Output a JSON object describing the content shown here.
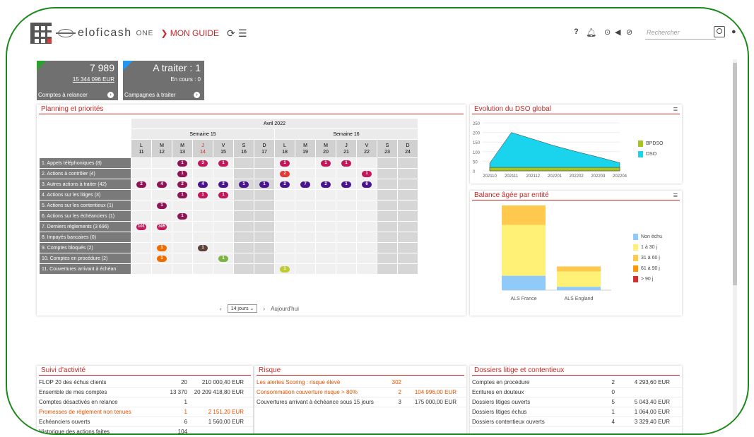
{
  "header": {
    "logo_text": "eloficash",
    "logo_suffix": "ONE",
    "guide": "❯ MON GUIDE",
    "search_placeholder": "Rechercher",
    "help": "?"
  },
  "kpis": [
    {
      "value": "7 989",
      "amount": "15 344 096 EUR",
      "footer": "Comptes à relancer",
      "color": "#2e9e2e"
    },
    {
      "value": "A traiter : 1",
      "amount": "En cours : 0",
      "footer": "Campagnes à traiter",
      "color": "#2196f3"
    }
  ],
  "planning": {
    "title": "Planning et priorités",
    "month": "Avril 2022",
    "weeks": [
      "Semaine 15",
      "Semaine 16"
    ],
    "days": [
      {
        "l": "L",
        "n": "11"
      },
      {
        "l": "M",
        "n": "12"
      },
      {
        "l": "M",
        "n": "13"
      },
      {
        "l": "J",
        "n": "14",
        "today": true
      },
      {
        "l": "V",
        "n": "15"
      },
      {
        "l": "S",
        "n": "16",
        "we": true
      },
      {
        "l": "D",
        "n": "17",
        "we": true
      },
      {
        "l": "L",
        "n": "18"
      },
      {
        "l": "M",
        "n": "19"
      },
      {
        "l": "M",
        "n": "20"
      },
      {
        "l": "J",
        "n": "21"
      },
      {
        "l": "V",
        "n": "22"
      },
      {
        "l": "S",
        "n": "23",
        "we": true
      },
      {
        "l": "D",
        "n": "24",
        "we": true
      }
    ],
    "rows": [
      {
        "label": "1. Appels téléphoniques (8)",
        "cells": {
          "2": [
            "1",
            "#8e1456"
          ],
          "3": [
            "3",
            "#c2185b"
          ],
          "4": [
            "1",
            "#c2185b"
          ],
          "7": [
            "1",
            "#c2185b"
          ],
          "9": [
            "1",
            "#c2185b"
          ],
          "10": [
            "1",
            "#c2185b"
          ]
        }
      },
      {
        "label": "2. Actions à contrôler (4)",
        "cells": {
          "2": [
            "1",
            "#8e1456"
          ],
          "7": [
            "2",
            "#e53935"
          ],
          "11": [
            "1",
            "#c2185b"
          ]
        }
      },
      {
        "label": "3. Autres actions à traiter (42)",
        "cells": {
          "0": [
            "2",
            "#8e1456"
          ],
          "1": [
            "4",
            "#8e1456"
          ],
          "2": [
            "2",
            "#8e1456"
          ],
          "3": [
            "4",
            "#4a148c"
          ],
          "4": [
            "2",
            "#4a148c"
          ],
          "5": [
            "1",
            "#4a148c"
          ],
          "6": [
            "1",
            "#4a148c"
          ],
          "7": [
            "2",
            "#4a148c"
          ],
          "8": [
            "7",
            "#4a148c"
          ],
          "9": [
            "2",
            "#4a148c"
          ],
          "10": [
            "1",
            "#4a148c"
          ],
          "11": [
            "6",
            "#4a148c"
          ]
        }
      },
      {
        "label": "4. Actions sur les litiges (3)",
        "cells": {
          "2": [
            "1",
            "#8e1456"
          ],
          "3": [
            "1",
            "#c2185b"
          ],
          "4": [
            "1",
            "#c2185b"
          ]
        }
      },
      {
        "label": "5. Actions sur les contentieux (1)",
        "cells": {
          "1": [
            "1",
            "#8e1456"
          ]
        }
      },
      {
        "label": "6. Actions sur les échéanciers (1)",
        "cells": {
          "2": [
            "1",
            "#8e1456"
          ]
        }
      },
      {
        "label": "7. Derniers règlements (3 696)",
        "cells": {
          "0": [
            "101",
            "#c2185b"
          ],
          "1": [
            "305",
            "#c2185b"
          ]
        }
      },
      {
        "label": "8. Impayés bancaires (0)",
        "cells": {}
      },
      {
        "label": "9. Comptes bloqués (2)",
        "cells": {
          "1": [
            "1",
            "#ef6c00"
          ],
          "3": [
            "1",
            "#5d4037"
          ]
        }
      },
      {
        "label": "10. Comptes en procédure (2)",
        "cells": {
          "1": [
            "1",
            "#ef6c00"
          ],
          "4": [
            "1",
            "#7cb342"
          ]
        }
      },
      {
        "label": "11. Couvertures arrivant à échéan",
        "cells": {
          "7": [
            "1",
            "#c0ca33"
          ]
        }
      }
    ],
    "footer": {
      "prev": "‹",
      "select": "14 jours",
      "next": "›",
      "today": "Aujourd'hui"
    }
  },
  "dso": {
    "title": "Evolution du DSO global",
    "chart_data": {
      "type": "area",
      "x": [
        "202110",
        "202111",
        "202112",
        "202201",
        "202202",
        "202203",
        "202204"
      ],
      "yticks": [
        "250",
        "200",
        "150",
        "100",
        "50",
        "0"
      ],
      "ylim": [
        0,
        250
      ],
      "series": [
        {
          "name": "BPDSO",
          "values": [
            18,
            18,
            18,
            18,
            18,
            18,
            18
          ],
          "color": "#a6c520"
        },
        {
          "name": "DSO",
          "values": [
            40,
            200,
            165,
            130,
            100,
            72,
            42
          ],
          "color": "#1ad4ee"
        }
      ]
    }
  },
  "balance": {
    "title": "Balance âgée par entité",
    "chart_data": {
      "type": "bar",
      "categories": [
        "ALS France",
        "ALS England"
      ],
      "series": [
        {
          "name": "Non échu",
          "values": [
            17,
            4
          ],
          "color": "#90caf9"
        },
        {
          "name": "1 à 30 j",
          "values": [
            60,
            18
          ],
          "color": "#fff176"
        },
        {
          "name": "31 à 60 j",
          "values": [
            23,
            6
          ],
          "color": "#ffc94d"
        },
        {
          "name": "61 à 90 j",
          "values": [
            0,
            0
          ],
          "color": "#ff9800"
        },
        {
          "name": "> 90 j",
          "values": [
            0,
            0
          ],
          "color": "#d32f2f"
        }
      ],
      "ylim": [
        0,
        100
      ]
    }
  },
  "suivi": {
    "title": "Suivi d'activité",
    "rows": [
      {
        "label": "FLOP 20 des échus clients",
        "n": "20",
        "amt": "210 000,40 EUR",
        "alert": false
      },
      {
        "label": "Ensemble de mes comptes",
        "n": "13 370",
        "amt": "20 209 418,80 EUR",
        "alert": false
      },
      {
        "label": "Comptes désactivés en relance",
        "n": "1",
        "amt": "",
        "alert": false
      },
      {
        "label": "Promesses de règlement non tenues",
        "n": "1",
        "amt": "2 151,20 EUR",
        "alert": true
      },
      {
        "label": "Echéanciers ouverts",
        "n": "6",
        "amt": "1 560,00 EUR",
        "alert": false
      },
      {
        "label": "Historique des actions faites",
        "n": "104",
        "amt": "",
        "alert": false
      }
    ]
  },
  "risque": {
    "title": "Risque",
    "rows": [
      {
        "label": "Les alertes Scoring : risque élevé",
        "n": "302",
        "amt": "",
        "alert": true
      },
      {
        "label": "Consommation couverture risque > 80%",
        "n": "2",
        "amt": "104 996,00 EUR",
        "alert": true
      },
      {
        "label": "Couvertures arrivant à échéance sous 15 jours",
        "n": "3",
        "amt": "175 000,00 EUR",
        "alert": false
      }
    ]
  },
  "litige": {
    "title": "Dossiers litige et contentieux",
    "rows": [
      {
        "label": "Comptes en procédure",
        "n": "2",
        "amt": "4 293,60 EUR"
      },
      {
        "label": "Ecritures en douteux",
        "n": "0",
        "amt": ""
      },
      {
        "label": "Dossiers litiges ouverts",
        "n": "5",
        "amt": "5 043,40 EUR"
      },
      {
        "label": "Dossiers litiges échus",
        "n": "1",
        "amt": "1 064,00 EUR"
      },
      {
        "label": "Dossiers contentieux ouverts",
        "n": "4",
        "amt": "3 329,40 EUR"
      }
    ]
  }
}
